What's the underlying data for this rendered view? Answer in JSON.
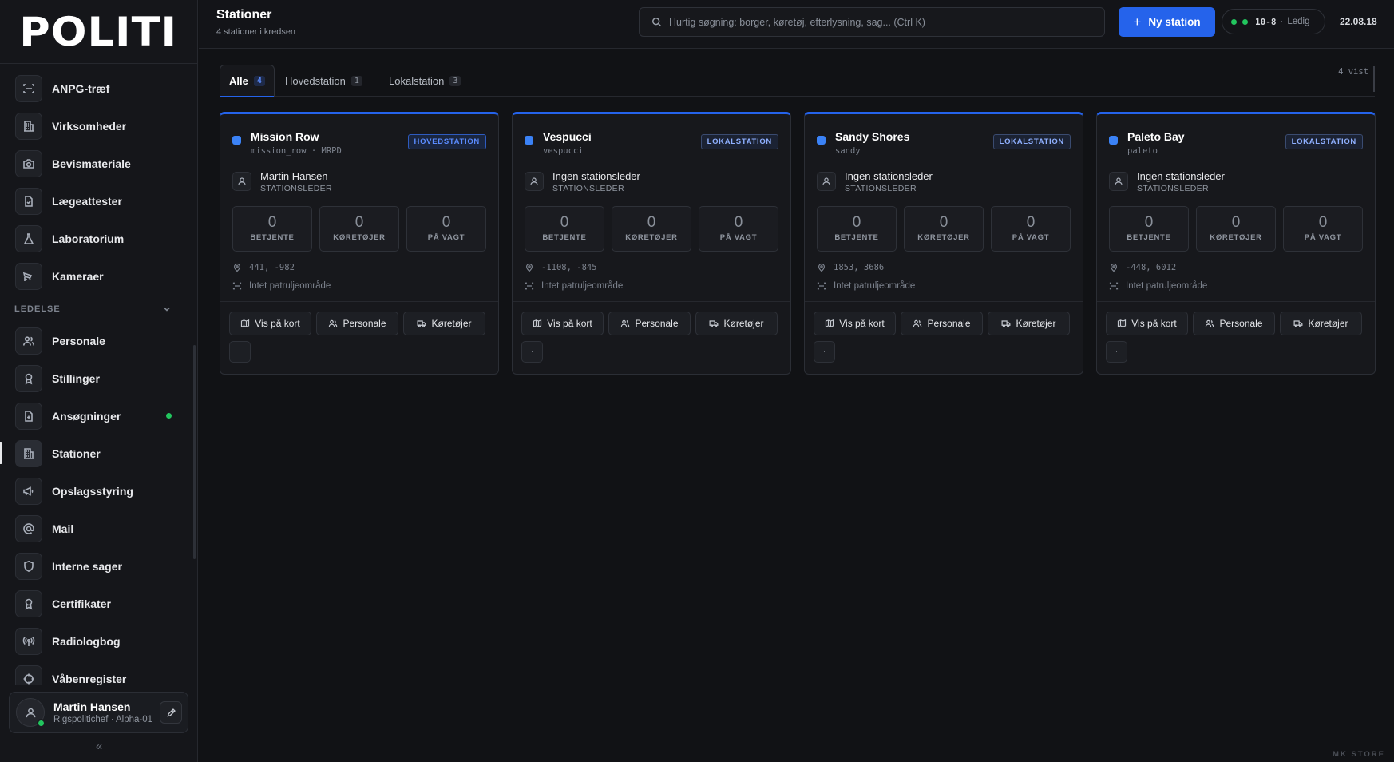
{
  "brand": {
    "logo_text": "POLITI"
  },
  "sidebar": {
    "items_top": [
      {
        "label": "ANPG-træf",
        "icon": "scan-icon"
      },
      {
        "label": "Virksomheder",
        "icon": "building-icon"
      },
      {
        "label": "Bevismateriale",
        "icon": "camera-icon"
      },
      {
        "label": "Lægeattester",
        "icon": "file-check-icon"
      },
      {
        "label": "Laboratorium",
        "icon": "flask-icon"
      },
      {
        "label": "Kameraer",
        "icon": "cctv-icon"
      }
    ],
    "section_label": "LEDELSE",
    "items_section": [
      {
        "label": "Personale",
        "icon": "users-icon"
      },
      {
        "label": "Stillinger",
        "icon": "award-icon"
      },
      {
        "label": "Ansøgninger",
        "icon": "file-plus-icon",
        "dot": true
      },
      {
        "label": "Stationer",
        "icon": "building-icon",
        "active": true
      },
      {
        "label": "Opslagsstyring",
        "icon": "megaphone-icon"
      },
      {
        "label": "Mail",
        "icon": "at-icon"
      },
      {
        "label": "Interne sager",
        "icon": "shield-icon"
      },
      {
        "label": "Certifikater",
        "icon": "award-icon"
      },
      {
        "label": "Radiologbog",
        "icon": "radio-icon"
      },
      {
        "label": "Våbenregister",
        "icon": "crosshair-icon"
      }
    ],
    "user": {
      "name": "Martin Hansen",
      "role": "Rigspolitichef · Alpha-01"
    },
    "collapse_glyph": "«"
  },
  "header": {
    "title": "Stationer",
    "subtitle": "4 stationer i kredsen",
    "search_placeholder": "Hurtig søgning: borger, køretøj, efterlysning, sag... (Ctrl K)",
    "new_button": "Ny station",
    "status_code": "10-8",
    "status_sep": "·",
    "status_text": "Ledig",
    "clock": "22.08.18"
  },
  "tabs": [
    {
      "label": "Alle",
      "count": "4",
      "active": true
    },
    {
      "label": "Hovedstation",
      "count": "1"
    },
    {
      "label": "Lokalstation",
      "count": "3"
    }
  ],
  "shown_count": "4 vist",
  "labels": {
    "leader_role": "STATIONSLEDER",
    "stat_officers": "BETJENTE",
    "stat_vehicles": "KØRETØJER",
    "stat_onduty": "PÅ VAGT",
    "patrol_none": "Intet patruljeområde",
    "action_map": "Vis på kort",
    "action_staff": "Personale",
    "action_vehicles": "Køretøjer",
    "small_btn": "·"
  },
  "stations": [
    {
      "name": "Mission Row",
      "slug": "mission_row · MRPD",
      "type": "HOVEDSTATION",
      "leader": "Martin Hansen",
      "officers": "0",
      "vehicles": "0",
      "on_duty": "0",
      "coords": "441, -982"
    },
    {
      "name": "Vespucci",
      "slug": "vespucci",
      "type": "LOKALSTATION",
      "leader": "Ingen stationsleder",
      "officers": "0",
      "vehicles": "0",
      "on_duty": "0",
      "coords": "-1108, -845"
    },
    {
      "name": "Sandy Shores",
      "slug": "sandy",
      "type": "LOKALSTATION",
      "leader": "Ingen stationsleder",
      "officers": "0",
      "vehicles": "0",
      "on_duty": "0",
      "coords": "1853, 3686"
    },
    {
      "name": "Paleto Bay",
      "slug": "paleto",
      "type": "LOKALSTATION",
      "leader": "Ingen stationsleder",
      "officers": "0",
      "vehicles": "0",
      "on_duty": "0",
      "coords": "-448, 6012"
    }
  ],
  "watermark": "MK STORE",
  "colors": {
    "accent": "#2563eb",
    "online": "#22c55e",
    "background": "#111215"
  }
}
